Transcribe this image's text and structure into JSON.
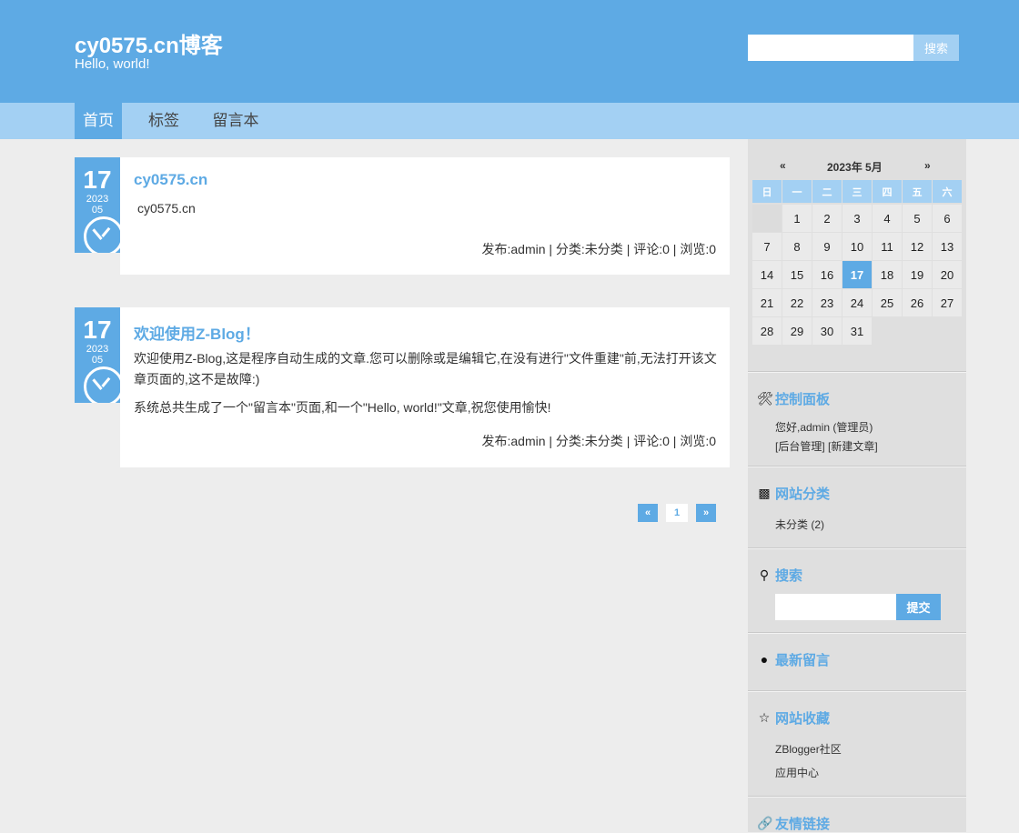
{
  "header": {
    "title": "cy0575.cn博客",
    "subtitle": "Hello, world!",
    "search_placeholder": "",
    "search_button": "搜索"
  },
  "nav": {
    "items": [
      {
        "label": "首页",
        "active": true
      },
      {
        "label": "标签",
        "active": false
      },
      {
        "label": "留言本",
        "active": false
      }
    ]
  },
  "posts": [
    {
      "day": "17",
      "year": "2023",
      "month": "05",
      "title": "cy0575.cn",
      "body": [
        "cy0575.cn"
      ],
      "meta": "发布:admin | 分类:未分类 | 评论:0 | 浏览:0"
    },
    {
      "day": "17",
      "year": "2023",
      "month": "05",
      "title": "欢迎使用Z-Blog！",
      "body": [
        "欢迎使用Z-Blog,这是程序自动生成的文章.您可以删除或是编辑它,在没有进行\"文件重建\"前,无法打开该文章页面的,这不是故障:)",
        "系统总共生成了一个\"留言本\"页面,和一个\"Hello, world!\"文章,祝您使用愉快!"
      ],
      "meta": "发布:admin | 分类:未分类 | 评论:0 | 浏览:0"
    }
  ],
  "pagination": {
    "prev": "«",
    "current": "1",
    "next": "»"
  },
  "calendar": {
    "prev": "«",
    "title": "2023年 5月",
    "next": "»",
    "weekdays": [
      "日",
      "一",
      "二",
      "三",
      "四",
      "五",
      "六"
    ],
    "weeks": [
      [
        "",
        "1",
        "2",
        "3",
        "4",
        "5",
        "6"
      ],
      [
        "7",
        "8",
        "9",
        "10",
        "11",
        "12",
        "13"
      ],
      [
        "14",
        "15",
        "16",
        "17",
        "18",
        "19",
        "20"
      ],
      [
        "21",
        "22",
        "23",
        "24",
        "25",
        "26",
        "27"
      ],
      [
        "28",
        "29",
        "30",
        "31",
        "",
        "",
        ""
      ]
    ],
    "today": "17"
  },
  "sidebar": {
    "control": {
      "title": "控制面板",
      "greeting": "您好,admin (管理员)",
      "links": "[后台管理]  [新建文章]"
    },
    "categories": {
      "title": "网站分类",
      "items": [
        "未分类 (2)"
      ]
    },
    "search": {
      "title": "搜索",
      "placeholder": "",
      "button": "提交"
    },
    "comments": {
      "title": "最新留言"
    },
    "favorites": {
      "title": "网站收藏",
      "items": [
        "ZBlogger社区",
        "应用中心"
      ]
    },
    "links": {
      "title": "友情链接"
    }
  }
}
